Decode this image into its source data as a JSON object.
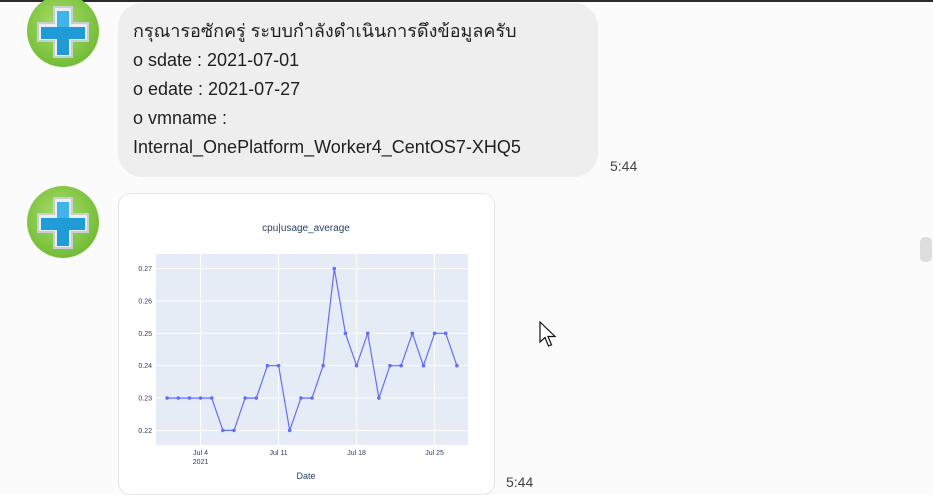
{
  "message1": {
    "lines": [
      "กรุณารอซักครู่ ระบบกำลังดำเนินการดึงข้อมูลครับ",
      "o sdate : 2021-07-01",
      "o edate : 2021-07-27",
      "o vmname :",
      "Internal_OnePlatform_Worker4_CentOS7-XHQ5"
    ],
    "time": "5:44"
  },
  "message2": {
    "time": "5:44"
  },
  "colors": {
    "bubble": "#eeeeee",
    "plot_bg": "#e5ecf6",
    "line": "#636efa",
    "avatar": "#7cc33f"
  },
  "icons": {
    "avatar": "medical-cross-icon",
    "cursor": "mouse-pointer-icon"
  },
  "chart_data": {
    "type": "line",
    "title": "cpu|usage_average",
    "xlabel": "Date",
    "ylabel": "",
    "x": [
      "2021-07-01",
      "2021-07-02",
      "2021-07-03",
      "2021-07-04",
      "2021-07-05",
      "2021-07-06",
      "2021-07-07",
      "2021-07-08",
      "2021-07-09",
      "2021-07-10",
      "2021-07-11",
      "2021-07-12",
      "2021-07-13",
      "2021-07-14",
      "2021-07-15",
      "2021-07-16",
      "2021-07-17",
      "2021-07-18",
      "2021-07-19",
      "2021-07-20",
      "2021-07-21",
      "2021-07-22",
      "2021-07-23",
      "2021-07-24",
      "2021-07-25",
      "2021-07-26",
      "2021-07-27"
    ],
    "series": [
      {
        "values": [
          0.23,
          0.23,
          0.23,
          0.23,
          0.23,
          0.22,
          0.22,
          0.23,
          0.23,
          0.24,
          0.24,
          0.22,
          0.23,
          0.23,
          0.24,
          0.27,
          0.25,
          0.24,
          0.25,
          0.23,
          0.24,
          0.24,
          0.25,
          0.24,
          0.25,
          0.25,
          0.24
        ]
      }
    ],
    "yticks": [
      0.22,
      0.23,
      0.24,
      0.25,
      0.26,
      0.27
    ],
    "ytick_labels": [
      "0.22",
      "0.23",
      "0.24",
      "0.25",
      "0.26",
      "0.27"
    ],
    "xticks": [
      {
        "date": "2021-07-04",
        "label": "Jul 4",
        "sub": "2021"
      },
      {
        "date": "2021-07-11",
        "label": "Jul 11",
        "sub": ""
      },
      {
        "date": "2021-07-18",
        "label": "Jul 18",
        "sub": ""
      },
      {
        "date": "2021-07-25",
        "label": "Jul 25",
        "sub": ""
      }
    ],
    "ylim": [
      0.2155,
      0.2745
    ],
    "xlim": [
      "2021-06-30",
      "2021-07-28"
    ],
    "grid": true
  }
}
